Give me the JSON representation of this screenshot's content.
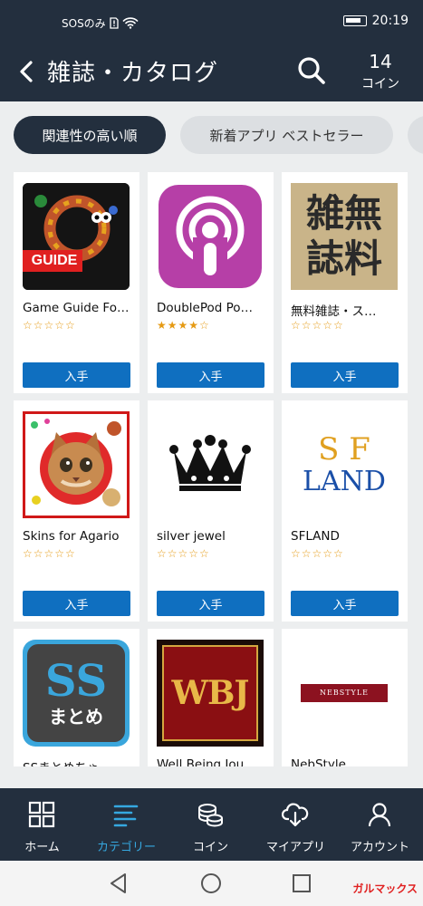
{
  "status": {
    "carrier": "SOSのみ",
    "time": "20:19"
  },
  "header": {
    "title": "雑誌・カタログ",
    "coin_count": "14",
    "coin_label": "コイン"
  },
  "sort_chips": [
    {
      "label": "関連性の高い順",
      "selected": true
    },
    {
      "label": "新着アプリ ベストセラー",
      "selected": false
    }
  ],
  "apps": [
    {
      "name": "Game Guide Fo…",
      "stars": "☆☆☆☆☆",
      "button": "入手",
      "icon": "game-guide-icon",
      "icon_text": "GUIDE"
    },
    {
      "name": "DoublePod Po…",
      "stars": "★★★★☆",
      "button": "入手",
      "icon": "podcast-icon"
    },
    {
      "name": "無料雑誌・ス…",
      "stars": "☆☆☆☆☆",
      "button": "入手",
      "icon": "free-magazine-icon",
      "icon_text": "雑無誌料"
    },
    {
      "name": "Skins for Agario",
      "stars": "☆☆☆☆☆",
      "button": "入手",
      "icon": "cat-icon"
    },
    {
      "name": "silver jewel",
      "stars": "☆☆☆☆☆",
      "button": "入手",
      "icon": "crown-icon"
    },
    {
      "name": "SFLAND",
      "stars": "☆☆☆☆☆",
      "button": "入手",
      "icon": "sfland-icon",
      "icon_text_1": "S F",
      "icon_text_2": "LAND"
    },
    {
      "name": "SSまとめちゃ…",
      "icon": "ss-matome-icon",
      "icon_text_1": "SS",
      "icon_text_2": "まとめ"
    },
    {
      "name": "Well Being Jou…",
      "icon": "wbj-icon",
      "icon_text": "WBJ"
    },
    {
      "name": "NebStyle",
      "icon": "nebstyle-icon",
      "icon_text": "NEBSTYLE"
    }
  ],
  "bottom_nav": [
    {
      "label": "ホーム",
      "icon": "home-grid-icon"
    },
    {
      "label": "カテゴリー",
      "icon": "category-list-icon",
      "active": true
    },
    {
      "label": "コイン",
      "icon": "coins-icon"
    },
    {
      "label": "マイアプリ",
      "icon": "cloud-download-icon"
    },
    {
      "label": "アカウント",
      "icon": "person-icon"
    }
  ],
  "watermark": "ガルマックス",
  "colors": {
    "header_bg": "#232f3e",
    "accent": "#35a8e0",
    "button": "#0f6fc0",
    "star": "#e59a13"
  }
}
